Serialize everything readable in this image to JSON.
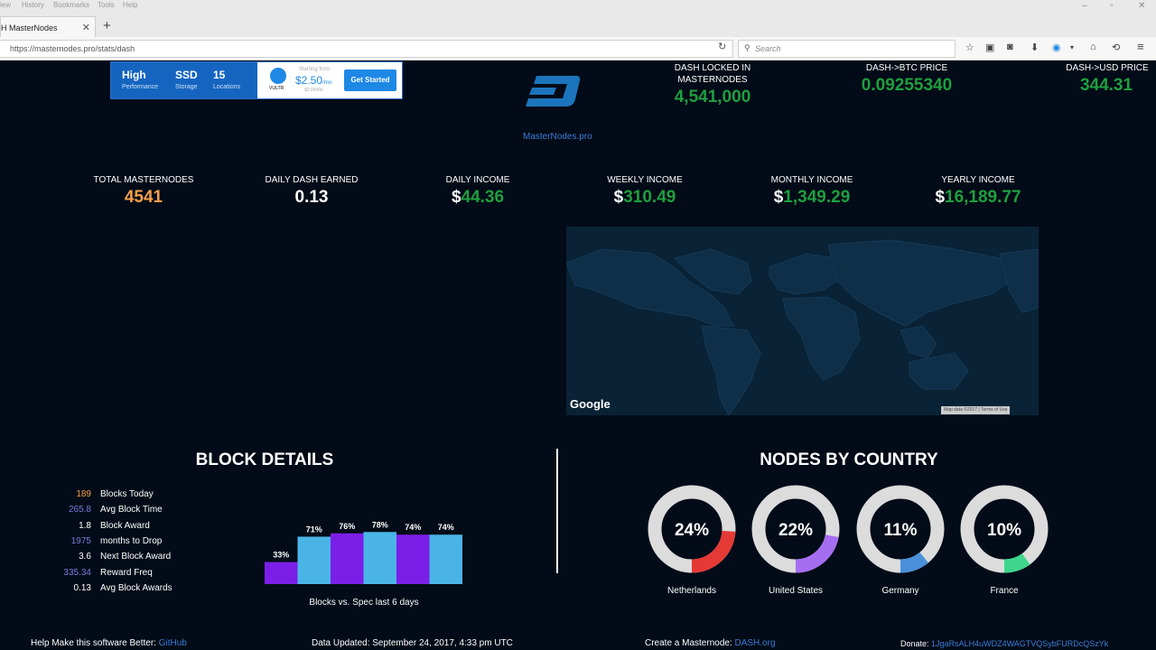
{
  "browser": {
    "menu": [
      "iew",
      "History",
      "Bookmarks",
      "Tools",
      "Help"
    ],
    "tab_title": "H MasterNodes",
    "url": "https://masternodes.pro/stats/dash",
    "search_placeholder": "Search"
  },
  "ad": {
    "high": "High",
    "high_sub": "Performance",
    "ssd": "SSD",
    "ssd_sub": "Storage",
    "locations": "15",
    "locations_sub": "Locations",
    "brand": "VULTR",
    "starting": "Starting from",
    "price": "$2.50",
    "price_unit": "/mo",
    "price_hour": "$0.004/hr",
    "cta": "Get Started"
  },
  "site_link": "MasterNodes.pro",
  "top_stats": {
    "locked_label": "DASH LOCKED IN MASTERNODES",
    "locked_value": "4,541,000",
    "btc_label": "DASH->BTC PRICE",
    "btc_value": "0.09255340",
    "usd_label": "DASH->USD PRICE",
    "usd_value": "344.31"
  },
  "metrics": {
    "total_label": "TOTAL MASTERNODES",
    "total_value": "4541",
    "daily_dash_label": "DAILY DASH EARNED",
    "daily_dash_value": "0.13",
    "daily_income_label": "DAILY INCOME",
    "daily_income_value": "44.36",
    "weekly_label": "WEEKLY INCOME",
    "weekly_value": "310.49",
    "monthly_label": "MONTHLY INCOME",
    "monthly_value": "1,349.29",
    "yearly_label": "YEARLY INCOME",
    "yearly_value": "16,189.77",
    "currency": "$"
  },
  "map": {
    "google": "Google",
    "attribution": "Map data ©2017 | Terms of Use"
  },
  "block_details": {
    "title": "BLOCK DETAILS",
    "rows": [
      {
        "value": "189",
        "label": "Blocks Today",
        "color": "#f5a04a"
      },
      {
        "value": "265.8",
        "label": "Avg Block Time",
        "color": "#7a7adf"
      },
      {
        "value": "1.8",
        "label": "Block Award",
        "color": "#ffffff"
      },
      {
        "value": "1975",
        "label": "months to Drop",
        "color": "#7a7adf"
      },
      {
        "value": "3.6",
        "label": "Next Block Award",
        "color": "#ffffff"
      },
      {
        "value": "335.34",
        "label": "Reward Freq",
        "color": "#7a7adf"
      },
      {
        "value": "0.13",
        "label": "Avg Block Awards",
        "color": "#ffffff"
      }
    ],
    "chart_caption": "Blocks vs. Spec last 6 days"
  },
  "chart_data": {
    "type": "bar",
    "categories": [
      "",
      "",
      "",
      "",
      "",
      ""
    ],
    "values": [
      33,
      71,
      76,
      78,
      74,
      74
    ],
    "labels": [
      "33%",
      "71%",
      "76%",
      "78%",
      "74%",
      "74%"
    ],
    "colors": [
      "#7b1fe8",
      "#4ab4e6",
      "#7b1fe8",
      "#4ab4e6",
      "#7b1fe8",
      "#4ab4e6"
    ],
    "ylim": [
      0,
      100
    ],
    "title": "",
    "xlabel": "Blocks vs. Spec last 6 days",
    "ylabel": ""
  },
  "nodes_by_country": {
    "title": "NODES BY COUNTRY",
    "countries": [
      {
        "name": "Netherlands",
        "pct": 24,
        "label": "24%",
        "color": "#e53935"
      },
      {
        "name": "United States",
        "pct": 22,
        "label": "22%",
        "color": "#a56ef0"
      },
      {
        "name": "Germany",
        "pct": 11,
        "label": "11%",
        "color": "#4a90d9"
      },
      {
        "name": "France",
        "pct": 10,
        "label": "10%",
        "color": "#3dd68c"
      }
    ]
  },
  "footer": {
    "help_text": "Help Make this software Better:",
    "help_link": "GitHub",
    "updated": "Data Updated: September 24, 2017, 4:33 pm UTC",
    "create_text": "Create a Masternode:",
    "create_link": "DASH.org",
    "donate_text": "Donate:",
    "donate_link": "1JgaRsALH4uWDZ4WAGTVQSybFURDcQSzYk"
  },
  "colors": {
    "accent_green": "#1f9f3f",
    "accent_orange": "#f5a04a",
    "link_blue": "#3d7dd8",
    "background": "#020b17"
  }
}
